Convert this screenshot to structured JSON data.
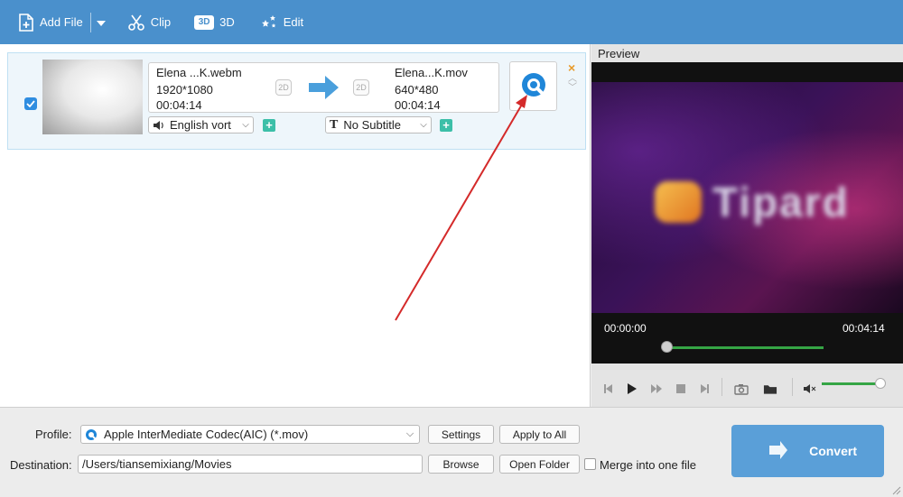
{
  "toolbar": {
    "add_file": "Add File",
    "clip": "Clip",
    "threed_badge": "3D",
    "threed": "3D",
    "edit": "Edit"
  },
  "file": {
    "source": {
      "name": "Elena ...K.webm",
      "resolution": "1920*1080",
      "duration": "00:04:14",
      "mode": "2D"
    },
    "target": {
      "name": "Elena...K.mov",
      "resolution": "640*480",
      "duration": "00:04:14",
      "mode": "2D"
    },
    "audio_track": "English vort",
    "subtitle_icon": "T",
    "subtitle": "No Subtitle",
    "checked": true
  },
  "preview": {
    "title": "Preview",
    "logo_text": "Tipard",
    "current_time": "00:00:00",
    "total_time": "00:04:14",
    "progress": 0,
    "volume": 0.9
  },
  "bottom": {
    "profile_label": "Profile:",
    "profile_value": "Apple InterMediate Codec(AIC) (*.mov)",
    "settings": "Settings",
    "apply_to_all": "Apply to All",
    "destination_label": "Destination:",
    "destination_value": "/Users/tiansemixiang/Movies",
    "browse": "Browse",
    "open_folder": "Open Folder",
    "merge_label": "Merge into one file",
    "convert": "Convert"
  },
  "colors": {
    "toolbar": "#4a90cc",
    "accent": "#2f8de0",
    "progress": "#35a545",
    "annotation_arrow": "#d42a2a"
  },
  "icons": [
    "add-file-icon",
    "scissors-icon",
    "3d-icon",
    "edit-stars-icon",
    "quicktime-icon",
    "speaker-icon",
    "text-icon",
    "snapshot-icon",
    "folder-icon",
    "convert-icon"
  ]
}
